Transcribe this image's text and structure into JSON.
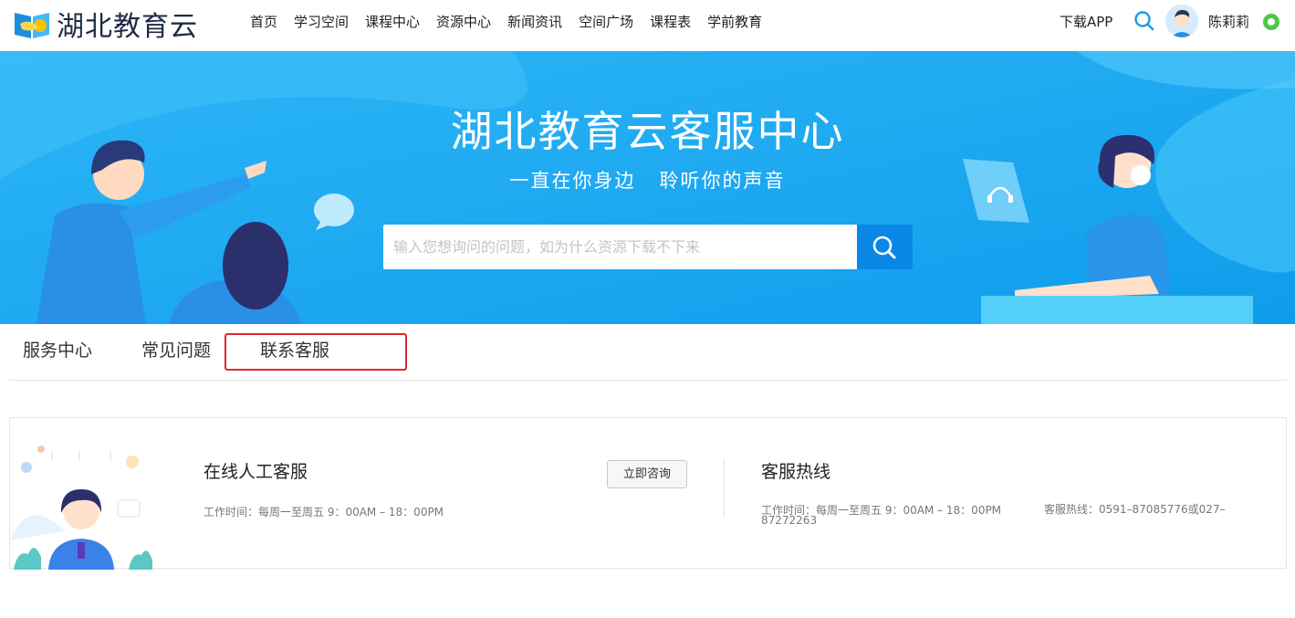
{
  "header": {
    "logo_text": "湖北教育云",
    "nav": [
      "首页",
      "学习空间",
      "课程中心",
      "资源中心",
      "新闻资讯",
      "空间广场",
      "课程表",
      "学前教育"
    ],
    "download_label": "下载APP",
    "username": "陈莉莉"
  },
  "banner": {
    "title": "湖北教育云客服中心",
    "subtitle": "一直在你身边   聆听你的声音",
    "search_placeholder": "输入您想询问的问题，如为什么资源下载不下来"
  },
  "tabs": [
    "服务中心",
    "常见问题",
    "联系客服"
  ],
  "contact": {
    "online": {
      "title": "在线人工客服",
      "hours": "工作时间：每周一至周五 9：00AM – 18：00PM",
      "button_label": "立即咨询"
    },
    "hotline": {
      "title": "客服热线",
      "hours": "工作时间：每周一至周五 9：00AM – 18：00PM",
      "phone": "客服热线：0591–87085776或027–87272263"
    }
  },
  "colors": {
    "banner_bg": "#1aa6f2",
    "search_button": "#0a87e6",
    "highlight_box": "#e0282a",
    "online_status": "#4cc94c"
  },
  "icons": [
    "logo-icon",
    "search-icon",
    "avatar",
    "online-status-icon",
    "chat-bubble-icon",
    "headset-icon"
  ]
}
